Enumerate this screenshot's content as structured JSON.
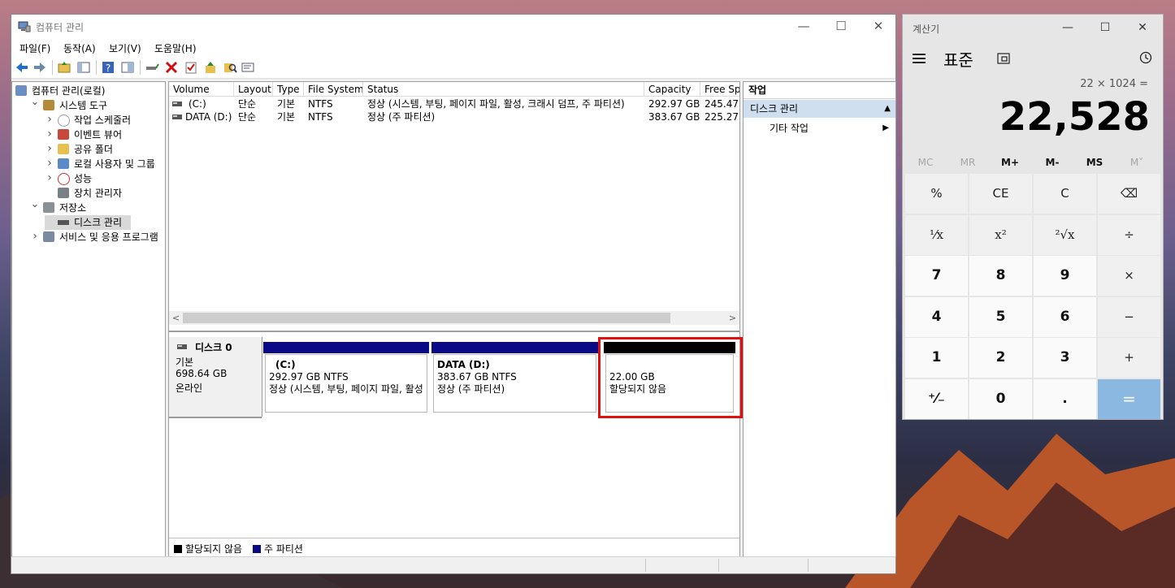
{
  "cm": {
    "title": "컴퓨터 관리",
    "menu": [
      "파일(F)",
      "동작(A)",
      "보기(V)",
      "도움말(H)"
    ],
    "tree": [
      {
        "label": "컴퓨터 관리(로컬)",
        "icon": "computer-management-icon",
        "level": 0,
        "chev": ""
      },
      {
        "label": "시스템 도구",
        "icon": "tools-icon",
        "level": 1,
        "chev": "v"
      },
      {
        "label": "작업 스케줄러",
        "icon": "clock-icon",
        "level": 2,
        "chev": ">"
      },
      {
        "label": "이벤트 뷰어",
        "icon": "event-viewer-icon",
        "level": 2,
        "chev": ">"
      },
      {
        "label": "공유 폴더",
        "icon": "shared-folder-icon",
        "level": 2,
        "chev": ">"
      },
      {
        "label": "로컬 사용자 및 그룹",
        "icon": "users-icon",
        "level": 2,
        "chev": ">"
      },
      {
        "label": "성능",
        "icon": "performance-icon",
        "level": 2,
        "chev": ">"
      },
      {
        "label": "장치 관리자",
        "icon": "device-manager-icon",
        "level": 2,
        "chev": ""
      },
      {
        "label": "저장소",
        "icon": "storage-icon",
        "level": 1,
        "chev": "v"
      },
      {
        "label": "디스크 관리",
        "icon": "disk-icon",
        "level": 2,
        "chev": ""
      },
      {
        "label": "서비스 및 응용 프로그램",
        "icon": "services-icon",
        "level": 1,
        "chev": ">"
      }
    ],
    "volume_table": {
      "columns": [
        "Volume",
        "Layout",
        "Type",
        "File System",
        "Status",
        "Capacity",
        "Free Sp"
      ],
      "rows": [
        [
          "(C:)",
          "단순",
          "기본",
          "NTFS",
          "정상 (시스템, 부팅, 페이지 파일, 활성, 크래시 덤프, 주 파티션)",
          "292.97 GB",
          "245.47"
        ],
        [
          "DATA (D:)",
          "단순",
          "기본",
          "NTFS",
          "정상 (주 파티션)",
          "383.67 GB",
          "225.27"
        ]
      ]
    },
    "disk": {
      "name": "디스크 0",
      "type": "기본",
      "size": "698.64 GB",
      "state": "온라인",
      "partitions": [
        {
          "name": "(C:)",
          "size_fs": "292.97 GB NTFS",
          "status": "정상 (시스템, 부팅, 페이지 파일, 활성",
          "bar_color": "#0a0a87"
        },
        {
          "name": "DATA  (D:)",
          "size_fs": "383.67 GB NTFS",
          "status": "정상 (주 파티션)",
          "bar_color": "#0a0a87"
        },
        {
          "name": "",
          "size_fs": "22.00 GB",
          "status": "할당되지 않음",
          "bar_color": "#000000"
        }
      ]
    },
    "legend": [
      {
        "label": "할당되지 않음",
        "color": "#000000"
      },
      {
        "label": "주 파티션",
        "color": "#0a0a87"
      }
    ],
    "actions": {
      "title": "작업",
      "section": "디스크 관리",
      "more": "기타 작업"
    }
  },
  "calc": {
    "title": "계산기",
    "mode": "표준",
    "expression": "22 × 1024 =",
    "result": "22,528",
    "memory": [
      "MC",
      "MR",
      "M+",
      "M-",
      "MS",
      "M˅"
    ],
    "keys": [
      [
        "%",
        "CE",
        "C",
        "⌫"
      ],
      [
        "¹⁄x",
        "x²",
        "²√x",
        "÷"
      ],
      [
        "7",
        "8",
        "9",
        "×"
      ],
      [
        "4",
        "5",
        "6",
        "−"
      ],
      [
        "1",
        "2",
        "3",
        "+"
      ],
      [
        "⁺⁄₋",
        "0",
        ".",
        "="
      ]
    ]
  }
}
